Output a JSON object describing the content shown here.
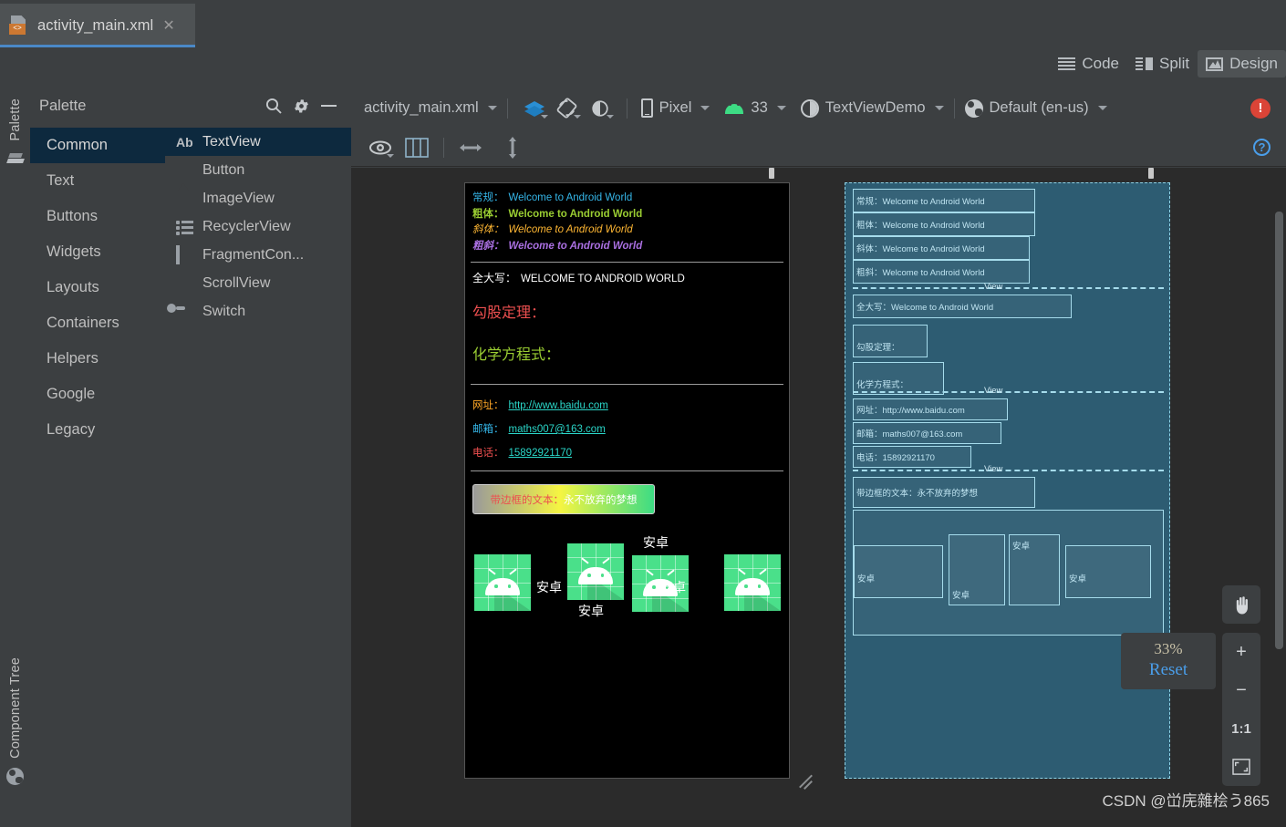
{
  "window": {
    "tab": {
      "filename": "activity_main.xml",
      "close_icon": "close-icon",
      "file_icon": "xml-file-icon"
    }
  },
  "modebar": {
    "items": [
      {
        "label": "Code",
        "icon": "code-lines-icon",
        "selected": false
      },
      {
        "label": "Split",
        "icon": "split-view-icon",
        "selected": false
      },
      {
        "label": "Design",
        "icon": "design-image-icon",
        "selected": true
      }
    ]
  },
  "palette": {
    "title": "Palette",
    "search_icon": "search-icon",
    "gear_icon": "gear-icon",
    "minimize_icon": "minimize-icon",
    "categories": [
      {
        "label": "Common",
        "selected": true
      },
      {
        "label": "Text",
        "selected": false
      },
      {
        "label": "Buttons",
        "selected": false
      },
      {
        "label": "Widgets",
        "selected": false
      },
      {
        "label": "Layouts",
        "selected": false
      },
      {
        "label": "Containers",
        "selected": false
      },
      {
        "label": "Helpers",
        "selected": false
      },
      {
        "label": "Google",
        "selected": false
      },
      {
        "label": "Legacy",
        "selected": false
      }
    ],
    "items": [
      {
        "label": "TextView",
        "icon": "textview-icon",
        "selected": true
      },
      {
        "label": "Button",
        "icon": "button-icon",
        "selected": false
      },
      {
        "label": "ImageView",
        "icon": "imageview-icon",
        "selected": false
      },
      {
        "label": "RecyclerView",
        "icon": "recyclerview-icon",
        "selected": false
      },
      {
        "label": "FragmentCon...",
        "icon": "fragment-icon",
        "selected": false
      },
      {
        "label": "ScrollView",
        "icon": "scrollview-icon",
        "selected": false
      },
      {
        "label": "Switch",
        "icon": "switch-icon",
        "selected": false
      }
    ]
  },
  "left_strips": {
    "palette_label": "Palette",
    "palette_icon": "palette-stack-icon",
    "component_tree_label": "Component Tree",
    "component_tree_icon": "globe-icon"
  },
  "design_toolbar": {
    "file_label": "activity_main.xml",
    "layout_variant_icon": "layers-icon",
    "orientation_icon": "rotate-device-icon",
    "theme_mode_icon": "night-mode-icon",
    "device_icon": "phone-icon",
    "device_label": "Pixel",
    "api_icon": "android-icon",
    "api_label": "33",
    "theme_icon": "theme-contrast-icon",
    "theme_label": "TextViewDemo",
    "locale_icon": "globe-icon",
    "locale_label": "Default (en-us)",
    "error_badge": "!",
    "error_icon": "error-circle-icon"
  },
  "view_toolbar": {
    "eye_icon": "eye-visibility-icon",
    "panels_icon": "panels-columns-icon",
    "width_icon": "horizontal-resize-icon",
    "height_icon": "vertical-resize-icon",
    "help_badge": "?",
    "help_icon": "help-circle-icon"
  },
  "preview": {
    "styles": [
      {
        "label": "常规：",
        "label_color": "#35b6e8",
        "text": "Welcome to Android World",
        "color": "#35b6e8",
        "bold": false,
        "italic": false
      },
      {
        "label": "粗体：",
        "label_color": "#9acd32",
        "text": "Welcome to Android World",
        "color": "#9acd32",
        "bold": true,
        "italic": false
      },
      {
        "label": "斜体：",
        "label_color": "#ffb733",
        "text": "Welcome to Android World",
        "color": "#ffb733",
        "bold": false,
        "italic": true
      },
      {
        "label": "粗斜：",
        "label_color": "#a96fe0",
        "text": "Welcome to Android World",
        "color": "#a96fe0",
        "bold": true,
        "italic": true
      }
    ],
    "uppercase": {
      "label": "全大写：",
      "text": "WELCOME TO ANDROID WORLD",
      "color": "#ffffff"
    },
    "pythagorean": {
      "label": "勾股定理：",
      "color": "#ec4f4f"
    },
    "chemistry": {
      "label": "化学方程式：",
      "color": "#9acd32"
    },
    "links": [
      {
        "label": "网址：",
        "label_color": "#ffa726",
        "value": "http://www.baidu.com",
        "value_color": "#2ad6c8"
      },
      {
        "label": "邮箱：",
        "label_color": "#35b6e8",
        "value": "maths007@163.com",
        "value_color": "#2ad6c8"
      },
      {
        "label": "电话：",
        "label_color": "#ec4f4f",
        "value": "15892921170",
        "value_color": "#2ad6c8"
      }
    ],
    "bordered": {
      "label": "带边框的文本：",
      "label_color": "#ec4f4f",
      "text": "永不放弃的梦想",
      "text_color": "#ffffff",
      "gradient_from": "#9a9a9a",
      "gradient_mid": "#f5f542",
      "gradient_to": "#3ddc84"
    },
    "droids": [
      {
        "label": "安卓",
        "position": "right"
      },
      {
        "label": "安卓",
        "position": "bottom"
      },
      {
        "label": "安卓",
        "position": "top"
      },
      {
        "label": "安卓",
        "position": "left"
      }
    ]
  },
  "blueprint": {
    "divider_label": "View",
    "rows": [
      "常规：Welcome to Android World",
      "粗体：Welcome to Android World",
      "斜体：Welcome to Android World",
      "粗斜：Welcome to Android World"
    ],
    "uppercase": "全大写：Welcome to Android World",
    "pythagorean": "勾股定理：",
    "chemistry": "化学方程式：",
    "links": [
      "网址：http://www.baidu.com",
      "邮箱：maths007@163.com",
      "电话：15892921170"
    ],
    "bordered": "带边框的文本：永不放弃的梦想",
    "droid_labels": [
      "安卓",
      "安卓",
      "安卓",
      "安卓"
    ]
  },
  "zoom_panel": {
    "percent": "33%",
    "reset_label": "Reset",
    "pan_icon": "hand-pan-icon",
    "zoom_in_label": "+",
    "zoom_out_label": "−",
    "actual_size_label": "1:1",
    "fit_icon": "fit-screen-icon"
  },
  "watermark": {
    "text": "CSDN @峃庑雜桧う865"
  }
}
